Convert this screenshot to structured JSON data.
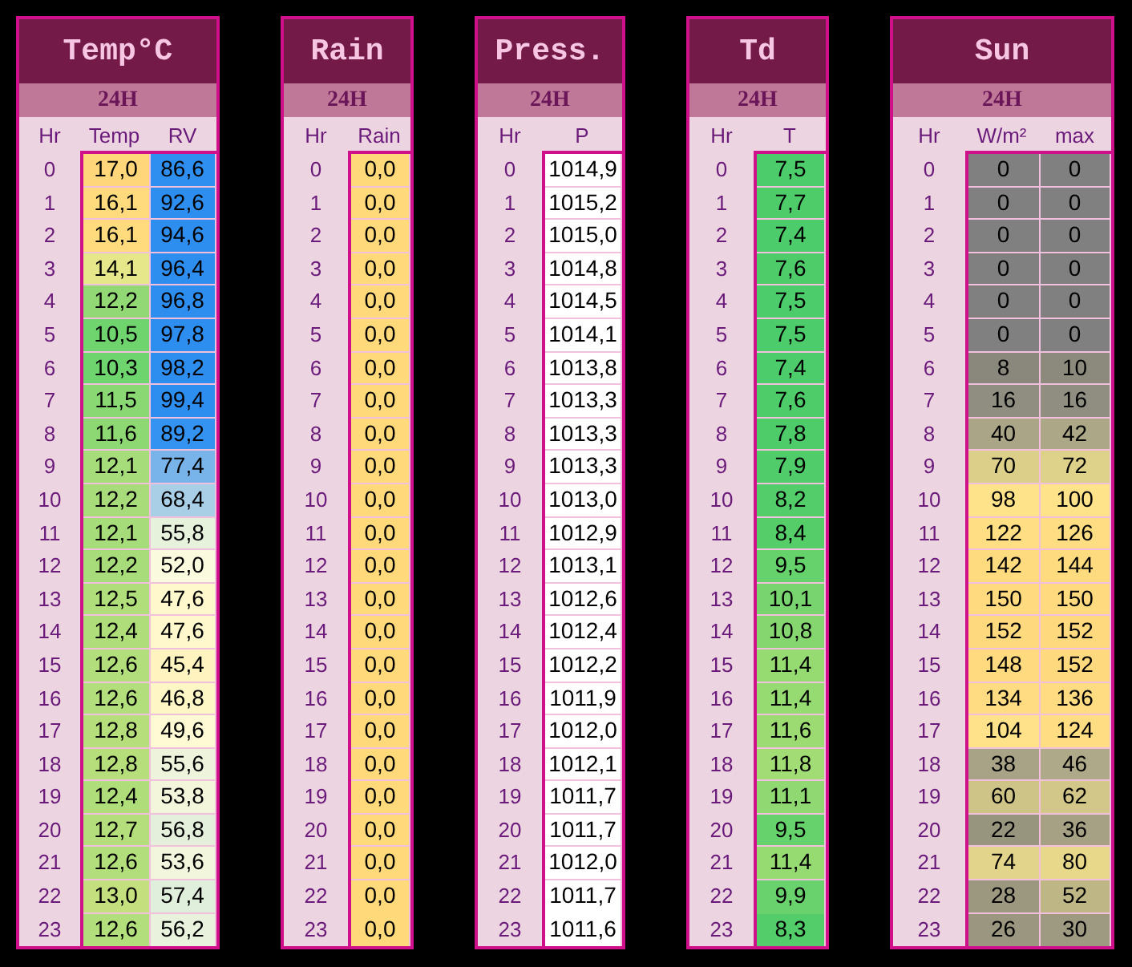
{
  "panels": [
    {
      "title": "Temp°C",
      "period": "24H",
      "hour_header": "Hr",
      "columns": [
        "Temp",
        "RV"
      ],
      "rows": [
        {
          "hour": "0",
          "cells": [
            {
              "text": "17,0",
              "color": "#ffd67a"
            },
            {
              "text": "86,6",
              "color": "#2f8ff0"
            }
          ]
        },
        {
          "hour": "1",
          "cells": [
            {
              "text": "16,1",
              "color": "#ffdb7e"
            },
            {
              "text": "92,6",
              "color": "#2e8ef0"
            }
          ]
        },
        {
          "hour": "2",
          "cells": [
            {
              "text": "16,1",
              "color": "#ffdb7e"
            },
            {
              "text": "94,6",
              "color": "#2e8ef0"
            }
          ]
        },
        {
          "hour": "3",
          "cells": [
            {
              "text": "14,1",
              "color": "#e6e68a"
            },
            {
              "text": "96,4",
              "color": "#2e8ef0"
            }
          ]
        },
        {
          "hour": "4",
          "cells": [
            {
              "text": "12,2",
              "color": "#92d874"
            },
            {
              "text": "96,8",
              "color": "#2e8ef0"
            }
          ]
        },
        {
          "hour": "5",
          "cells": [
            {
              "text": "10,5",
              "color": "#70d46e"
            },
            {
              "text": "97,8",
              "color": "#2e8ef0"
            }
          ]
        },
        {
          "hour": "6",
          "cells": [
            {
              "text": "10,3",
              "color": "#6ed46e"
            },
            {
              "text": "98,2",
              "color": "#2e8ef0"
            }
          ]
        },
        {
          "hour": "7",
          "cells": [
            {
              "text": "11,5",
              "color": "#8ad873"
            },
            {
              "text": "99,4",
              "color": "#2e8ef0"
            }
          ]
        },
        {
          "hour": "8",
          "cells": [
            {
              "text": "11,6",
              "color": "#8ed873"
            },
            {
              "text": "89,2",
              "color": "#3493f0"
            }
          ]
        },
        {
          "hour": "9",
          "cells": [
            {
              "text": "12,1",
              "color": "#a6dc7a"
            },
            {
              "text": "77,4",
              "color": "#78b4ea"
            }
          ]
        },
        {
          "hour": "10",
          "cells": [
            {
              "text": "12,2",
              "color": "#a8dc7a"
            },
            {
              "text": "68,4",
              "color": "#a8cfe6"
            }
          ]
        },
        {
          "hour": "11",
          "cells": [
            {
              "text": "12,1",
              "color": "#a6dc7a"
            },
            {
              "text": "55,8",
              "color": "#e6f2dc"
            }
          ]
        },
        {
          "hour": "12",
          "cells": [
            {
              "text": "12,2",
              "color": "#a8dc7a"
            },
            {
              "text": "52,0",
              "color": "#fafade"
            }
          ]
        },
        {
          "hour": "13",
          "cells": [
            {
              "text": "12,5",
              "color": "#b0de7a"
            },
            {
              "text": "47,6",
              "color": "#fff8cc"
            }
          ]
        },
        {
          "hour": "14",
          "cells": [
            {
              "text": "12,4",
              "color": "#aedd7a"
            },
            {
              "text": "47,6",
              "color": "#fff8cc"
            }
          ]
        },
        {
          "hour": "15",
          "cells": [
            {
              "text": "12,6",
              "color": "#b2de7b"
            },
            {
              "text": "45,4",
              "color": "#fff4c0"
            }
          ]
        },
        {
          "hour": "16",
          "cells": [
            {
              "text": "12,6",
              "color": "#b2de7b"
            },
            {
              "text": "46,8",
              "color": "#fff6c6"
            }
          ]
        },
        {
          "hour": "17",
          "cells": [
            {
              "text": "12,8",
              "color": "#b6df7c"
            },
            {
              "text": "49,6",
              "color": "#fffad4"
            }
          ]
        },
        {
          "hour": "18",
          "cells": [
            {
              "text": "12,8",
              "color": "#b6df7c"
            },
            {
              "text": "55,6",
              "color": "#eef4dc"
            }
          ]
        },
        {
          "hour": "19",
          "cells": [
            {
              "text": "12,4",
              "color": "#aedd7a"
            },
            {
              "text": "53,8",
              "color": "#f4f6dc"
            }
          ]
        },
        {
          "hour": "20",
          "cells": [
            {
              "text": "12,7",
              "color": "#b4de7b"
            },
            {
              "text": "56,8",
              "color": "#e4f0dc"
            }
          ]
        },
        {
          "hour": "21",
          "cells": [
            {
              "text": "12,6",
              "color": "#b2de7b"
            },
            {
              "text": "53,6",
              "color": "#f2f6dc"
            }
          ]
        },
        {
          "hour": "22",
          "cells": [
            {
              "text": "13,0",
              "color": "#c4e07e"
            },
            {
              "text": "57,4",
              "color": "#e0eedc"
            }
          ]
        },
        {
          "hour": "23",
          "cells": [
            {
              "text": "12,6",
              "color": "#b2de7b"
            },
            {
              "text": "56,2",
              "color": "#e8f2dc"
            }
          ]
        }
      ]
    },
    {
      "title": "Rain",
      "period": "24H",
      "hour_header": "Hr",
      "columns": [
        "Rain"
      ],
      "rows": [
        {
          "hour": "0",
          "cells": [
            {
              "text": "0,0",
              "color": "#ffd97a"
            }
          ]
        },
        {
          "hour": "1",
          "cells": [
            {
              "text": "0,0",
              "color": "#ffd97a"
            }
          ]
        },
        {
          "hour": "2",
          "cells": [
            {
              "text": "0,0",
              "color": "#ffd97a"
            }
          ]
        },
        {
          "hour": "3",
          "cells": [
            {
              "text": "0,0",
              "color": "#ffd97a"
            }
          ]
        },
        {
          "hour": "4",
          "cells": [
            {
              "text": "0,0",
              "color": "#ffd97a"
            }
          ]
        },
        {
          "hour": "5",
          "cells": [
            {
              "text": "0,0",
              "color": "#ffd97a"
            }
          ]
        },
        {
          "hour": "6",
          "cells": [
            {
              "text": "0,0",
              "color": "#ffd97a"
            }
          ]
        },
        {
          "hour": "7",
          "cells": [
            {
              "text": "0,0",
              "color": "#ffd97a"
            }
          ]
        },
        {
          "hour": "8",
          "cells": [
            {
              "text": "0,0",
              "color": "#ffd97a"
            }
          ]
        },
        {
          "hour": "9",
          "cells": [
            {
              "text": "0,0",
              "color": "#ffd97a"
            }
          ]
        },
        {
          "hour": "10",
          "cells": [
            {
              "text": "0,0",
              "color": "#ffd97a"
            }
          ]
        },
        {
          "hour": "11",
          "cells": [
            {
              "text": "0,0",
              "color": "#ffd97a"
            }
          ]
        },
        {
          "hour": "12",
          "cells": [
            {
              "text": "0,0",
              "color": "#ffd97a"
            }
          ]
        },
        {
          "hour": "13",
          "cells": [
            {
              "text": "0,0",
              "color": "#ffd97a"
            }
          ]
        },
        {
          "hour": "14",
          "cells": [
            {
              "text": "0,0",
              "color": "#ffd97a"
            }
          ]
        },
        {
          "hour": "15",
          "cells": [
            {
              "text": "0,0",
              "color": "#ffd97a"
            }
          ]
        },
        {
          "hour": "16",
          "cells": [
            {
              "text": "0,0",
              "color": "#ffd97a"
            }
          ]
        },
        {
          "hour": "17",
          "cells": [
            {
              "text": "0,0",
              "color": "#ffd97a"
            }
          ]
        },
        {
          "hour": "18",
          "cells": [
            {
              "text": "0,0",
              "color": "#ffd97a"
            }
          ]
        },
        {
          "hour": "19",
          "cells": [
            {
              "text": "0,0",
              "color": "#ffd97a"
            }
          ]
        },
        {
          "hour": "20",
          "cells": [
            {
              "text": "0,0",
              "color": "#ffd97a"
            }
          ]
        },
        {
          "hour": "21",
          "cells": [
            {
              "text": "0,0",
              "color": "#ffd97a"
            }
          ]
        },
        {
          "hour": "22",
          "cells": [
            {
              "text": "0,0",
              "color": "#ffd97a"
            }
          ]
        },
        {
          "hour": "23",
          "cells": [
            {
              "text": "0,0",
              "color": "#ffd97a"
            }
          ]
        }
      ]
    },
    {
      "title": "Press.",
      "period": "24H",
      "hour_header": "Hr",
      "columns": [
        "P"
      ],
      "rows": [
        {
          "hour": "0",
          "cells": [
            {
              "text": "1014,9",
              "color": "#ffffff"
            }
          ]
        },
        {
          "hour": "1",
          "cells": [
            {
              "text": "1015,2",
              "color": "#ffffff"
            }
          ]
        },
        {
          "hour": "2",
          "cells": [
            {
              "text": "1015,0",
              "color": "#ffffff"
            }
          ]
        },
        {
          "hour": "3",
          "cells": [
            {
              "text": "1014,8",
              "color": "#ffffff"
            }
          ]
        },
        {
          "hour": "4",
          "cells": [
            {
              "text": "1014,5",
              "color": "#ffffff"
            }
          ]
        },
        {
          "hour": "5",
          "cells": [
            {
              "text": "1014,1",
              "color": "#ffffff"
            }
          ]
        },
        {
          "hour": "6",
          "cells": [
            {
              "text": "1013,8",
              "color": "#ffffff"
            }
          ]
        },
        {
          "hour": "7",
          "cells": [
            {
              "text": "1013,3",
              "color": "#ffffff"
            }
          ]
        },
        {
          "hour": "8",
          "cells": [
            {
              "text": "1013,3",
              "color": "#ffffff"
            }
          ]
        },
        {
          "hour": "9",
          "cells": [
            {
              "text": "1013,3",
              "color": "#ffffff"
            }
          ]
        },
        {
          "hour": "10",
          "cells": [
            {
              "text": "1013,0",
              "color": "#ffffff"
            }
          ]
        },
        {
          "hour": "11",
          "cells": [
            {
              "text": "1012,9",
              "color": "#ffffff"
            }
          ]
        },
        {
          "hour": "12",
          "cells": [
            {
              "text": "1013,1",
              "color": "#ffffff"
            }
          ]
        },
        {
          "hour": "13",
          "cells": [
            {
              "text": "1012,6",
              "color": "#ffffff"
            }
          ]
        },
        {
          "hour": "14",
          "cells": [
            {
              "text": "1012,4",
              "color": "#ffffff"
            }
          ]
        },
        {
          "hour": "15",
          "cells": [
            {
              "text": "1012,2",
              "color": "#ffffff"
            }
          ]
        },
        {
          "hour": "16",
          "cells": [
            {
              "text": "1011,9",
              "color": "#ffffff"
            }
          ]
        },
        {
          "hour": "17",
          "cells": [
            {
              "text": "1012,0",
              "color": "#ffffff"
            }
          ]
        },
        {
          "hour": "18",
          "cells": [
            {
              "text": "1012,1",
              "color": "#ffffff"
            }
          ]
        },
        {
          "hour": "19",
          "cells": [
            {
              "text": "1011,7",
              "color": "#ffffff"
            }
          ]
        },
        {
          "hour": "20",
          "cells": [
            {
              "text": "1011,7",
              "color": "#ffffff"
            }
          ]
        },
        {
          "hour": "21",
          "cells": [
            {
              "text": "1012,0",
              "color": "#ffffff"
            }
          ]
        },
        {
          "hour": "22",
          "cells": [
            {
              "text": "1011,7",
              "color": "#ffffff"
            }
          ]
        },
        {
          "hour": "23",
          "cells": [
            {
              "text": "1011,6",
              "color": "#ffffff"
            }
          ]
        }
      ]
    },
    {
      "title": "Td",
      "period": "24H",
      "hour_header": "Hr",
      "columns": [
        "T"
      ],
      "rows": [
        {
          "hour": "0",
          "cells": [
            {
              "text": "7,5",
              "color": "#4ccc6a"
            }
          ]
        },
        {
          "hour": "1",
          "cells": [
            {
              "text": "7,7",
              "color": "#4ecc6a"
            }
          ]
        },
        {
          "hour": "2",
          "cells": [
            {
              "text": "7,4",
              "color": "#4ccc6a"
            }
          ]
        },
        {
          "hour": "3",
          "cells": [
            {
              "text": "7,6",
              "color": "#4ecc6a"
            }
          ]
        },
        {
          "hour": "4",
          "cells": [
            {
              "text": "7,5",
              "color": "#4ccc6a"
            }
          ]
        },
        {
          "hour": "5",
          "cells": [
            {
              "text": "7,5",
              "color": "#4ccc6a"
            }
          ]
        },
        {
          "hour": "6",
          "cells": [
            {
              "text": "7,4",
              "color": "#4ccc6a"
            }
          ]
        },
        {
          "hour": "7",
          "cells": [
            {
              "text": "7,6",
              "color": "#4ecc6a"
            }
          ]
        },
        {
          "hour": "8",
          "cells": [
            {
              "text": "7,8",
              "color": "#4ecc6a"
            }
          ]
        },
        {
          "hour": "9",
          "cells": [
            {
              "text": "7,9",
              "color": "#50cd6a"
            }
          ]
        },
        {
          "hour": "10",
          "cells": [
            {
              "text": "8,2",
              "color": "#52cd6a"
            }
          ]
        },
        {
          "hour": "11",
          "cells": [
            {
              "text": "8,4",
              "color": "#55ce6a"
            }
          ]
        },
        {
          "hour": "12",
          "cells": [
            {
              "text": "9,5",
              "color": "#66d26c"
            }
          ]
        },
        {
          "hour": "13",
          "cells": [
            {
              "text": "10,1",
              "color": "#78d46e"
            }
          ]
        },
        {
          "hour": "14",
          "cells": [
            {
              "text": "10,8",
              "color": "#86d670"
            }
          ]
        },
        {
          "hour": "15",
          "cells": [
            {
              "text": "11,4",
              "color": "#96da72"
            }
          ]
        },
        {
          "hour": "16",
          "cells": [
            {
              "text": "11,4",
              "color": "#96da72"
            }
          ]
        },
        {
          "hour": "17",
          "cells": [
            {
              "text": "11,6",
              "color": "#9cdb72"
            }
          ]
        },
        {
          "hour": "18",
          "cells": [
            {
              "text": "11,8",
              "color": "#a2dc74"
            }
          ]
        },
        {
          "hour": "19",
          "cells": [
            {
              "text": "11,1",
              "color": "#90d872"
            }
          ]
        },
        {
          "hour": "20",
          "cells": [
            {
              "text": "9,5",
              "color": "#66d26c"
            }
          ]
        },
        {
          "hour": "21",
          "cells": [
            {
              "text": "11,4",
              "color": "#96da72"
            }
          ]
        },
        {
          "hour": "22",
          "cells": [
            {
              "text": "9,9",
              "color": "#6ad26c"
            }
          ]
        },
        {
          "hour": "23",
          "cells": [
            {
              "text": "8,3",
              "color": "#52cd6a"
            }
          ]
        }
      ]
    },
    {
      "title": "Sun",
      "period": "24H",
      "hour_header": "Hr",
      "columns": [
        "W/m²",
        "max"
      ],
      "rows": [
        {
          "hour": "0",
          "cells": [
            {
              "text": "0",
              "color": "#808080"
            },
            {
              "text": "0",
              "color": "#808080"
            }
          ]
        },
        {
          "hour": "1",
          "cells": [
            {
              "text": "0",
              "color": "#808080"
            },
            {
              "text": "0",
              "color": "#808080"
            }
          ]
        },
        {
          "hour": "2",
          "cells": [
            {
              "text": "0",
              "color": "#808080"
            },
            {
              "text": "0",
              "color": "#808080"
            }
          ]
        },
        {
          "hour": "3",
          "cells": [
            {
              "text": "0",
              "color": "#808080"
            },
            {
              "text": "0",
              "color": "#808080"
            }
          ]
        },
        {
          "hour": "4",
          "cells": [
            {
              "text": "0",
              "color": "#808080"
            },
            {
              "text": "0",
              "color": "#808080"
            }
          ]
        },
        {
          "hour": "5",
          "cells": [
            {
              "text": "0",
              "color": "#808080"
            },
            {
              "text": "0",
              "color": "#808080"
            }
          ]
        },
        {
          "hour": "6",
          "cells": [
            {
              "text": "8",
              "color": "#8a887c"
            },
            {
              "text": "10",
              "color": "#8c8a7c"
            }
          ]
        },
        {
          "hour": "7",
          "cells": [
            {
              "text": "16",
              "color": "#908e80"
            },
            {
              "text": "16",
              "color": "#908e80"
            }
          ]
        },
        {
          "hour": "8",
          "cells": [
            {
              "text": "40",
              "color": "#aaa586"
            },
            {
              "text": "42",
              "color": "#aca786"
            }
          ]
        },
        {
          "hour": "9",
          "cells": [
            {
              "text": "70",
              "color": "#dccf8a"
            },
            {
              "text": "72",
              "color": "#ded18a"
            }
          ]
        },
        {
          "hour": "10",
          "cells": [
            {
              "text": "98",
              "color": "#ffe38a"
            },
            {
              "text": "100",
              "color": "#ffe38a"
            }
          ]
        },
        {
          "hour": "11",
          "cells": [
            {
              "text": "122",
              "color": "#ffde84"
            },
            {
              "text": "126",
              "color": "#ffdd82"
            }
          ]
        },
        {
          "hour": "12",
          "cells": [
            {
              "text": "142",
              "color": "#ffdb80"
            },
            {
              "text": "144",
              "color": "#ffdb80"
            }
          ]
        },
        {
          "hour": "13",
          "cells": [
            {
              "text": "150",
              "color": "#ffda7e"
            },
            {
              "text": "150",
              "color": "#ffda7e"
            }
          ]
        },
        {
          "hour": "14",
          "cells": [
            {
              "text": "152",
              "color": "#ffd97e"
            },
            {
              "text": "152",
              "color": "#ffd97e"
            }
          ]
        },
        {
          "hour": "15",
          "cells": [
            {
              "text": "148",
              "color": "#ffda7e"
            },
            {
              "text": "152",
              "color": "#ffd97e"
            }
          ]
        },
        {
          "hour": "16",
          "cells": [
            {
              "text": "134",
              "color": "#ffdc82"
            },
            {
              "text": "136",
              "color": "#ffdc82"
            }
          ]
        },
        {
          "hour": "17",
          "cells": [
            {
              "text": "104",
              "color": "#ffe28a"
            },
            {
              "text": "124",
              "color": "#ffdd82"
            }
          ]
        },
        {
          "hour": "18",
          "cells": [
            {
              "text": "38",
              "color": "#a8a386"
            },
            {
              "text": "46",
              "color": "#aea988"
            }
          ]
        },
        {
          "hour": "19",
          "cells": [
            {
              "text": "60",
              "color": "#cfc488"
            },
            {
              "text": "62",
              "color": "#d2c688"
            }
          ]
        },
        {
          "hour": "20",
          "cells": [
            {
              "text": "22",
              "color": "#98957f"
            },
            {
              "text": "36",
              "color": "#a6a184"
            }
          ]
        },
        {
          "hour": "21",
          "cells": [
            {
              "text": "74",
              "color": "#e2d48a"
            },
            {
              "text": "80",
              "color": "#e8d88a"
            }
          ]
        },
        {
          "hour": "22",
          "cells": [
            {
              "text": "28",
              "color": "#9c9880"
            },
            {
              "text": "52",
              "color": "#bfb686"
            }
          ]
        },
        {
          "hour": "23",
          "cells": [
            {
              "text": "26",
              "color": "#9a9680"
            },
            {
              "text": "30",
              "color": "#9e9a82"
            }
          ]
        }
      ]
    }
  ]
}
